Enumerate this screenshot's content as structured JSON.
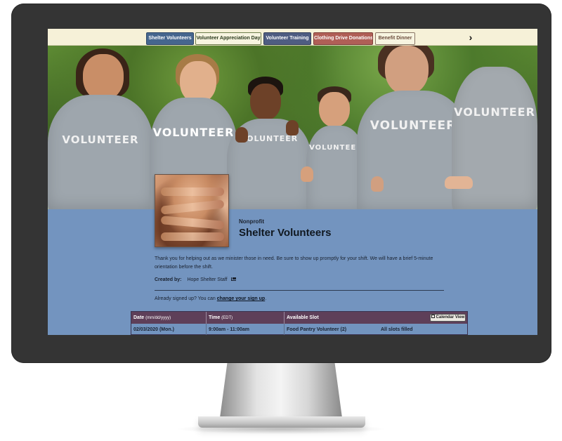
{
  "tabs": [
    {
      "label": "Shelter Volunteers"
    },
    {
      "label": "Volunteer Appreciation Day"
    },
    {
      "label": "Volunteer Training"
    },
    {
      "label": "Clothing Drive Donations"
    },
    {
      "label": "Benefit Dinner"
    }
  ],
  "tab_next_glyph": "›",
  "hero": {
    "shirt_text": "VOLUNTEER"
  },
  "org": {
    "type": "Nonprofit",
    "title": "Shelter Volunteers",
    "description": "Thank you for helping out as we minister those in need. Be sure to show up promptly for your shift. We will have a brief 5-minute orientation before the shift.",
    "created_label": "Created by:",
    "created_value": "Hope Shelter Staff"
  },
  "signup": {
    "text": "Already signed up? You can",
    "link": "change your sign up",
    "suffix": "."
  },
  "table": {
    "headers": {
      "date": "Date",
      "date_sub": "(mm/dd/yyyy)",
      "time": "Time",
      "time_sub": "(EDT)",
      "slot": "Available Slot"
    },
    "calendar_button": "Calendar View",
    "rows": [
      {
        "date": "02/03/2020 (Mon.)",
        "time": "9:00am - 11:00am",
        "slot": "Food Pantry Volunteer (2)",
        "status": "All slots filled"
      }
    ]
  },
  "colors": {
    "page_bg": "#7394bf",
    "tabbar_bg": "#f6f1d8",
    "table_header": "#5e3f59",
    "monitor": "#343434"
  }
}
